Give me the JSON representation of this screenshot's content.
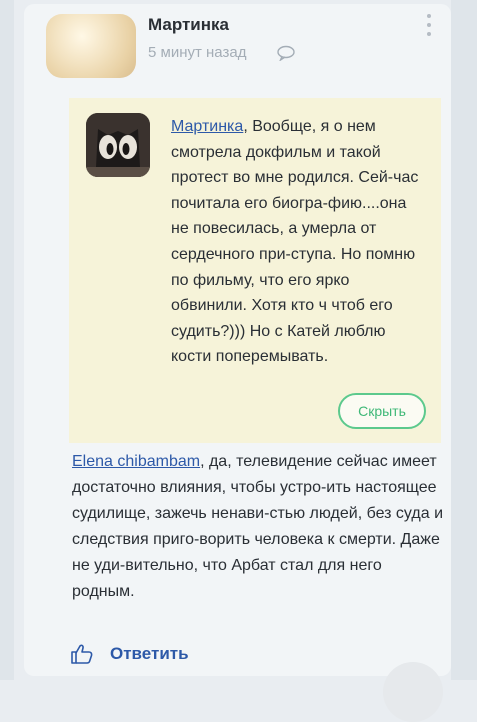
{
  "comment": {
    "author": "Мартинка",
    "time": "5 минут назад",
    "quote": {
      "author_link": "Мартинка",
      "text": ", Вообще, я о нем смотрела докфильм и такой протест во мне родился. Сей-час почитала его биогра-фию....она не повесилась, а умерла от сердечного при-ступа. Но помню по фильму, что его ярко обвинили. Хотя кто ч чтоб его судить?))) Но с Катей люблю кости поперемывать.",
      "hide_label": "Скрыть"
    },
    "reply_to_link": "Elena chibambam",
    "text": ", да, телевидение сейчас имеет достаточно влияния, чтобы устро-ить настоящее судилище, зажечь ненави-стью людей, без суда и следствия приго-ворить человека к смерти. Даже не уди-вительно, что Арбат стал для него родным.",
    "reply_label": "Ответить"
  },
  "icons": {
    "reply_bubble": "speech-bubble-icon",
    "like": "thumbs-up-icon",
    "menu": "kebab-menu-icon"
  },
  "colors": {
    "link": "#2d59a8",
    "quote_bg": "#f6f3d9",
    "hide_button_accent": "#5cc98d"
  }
}
